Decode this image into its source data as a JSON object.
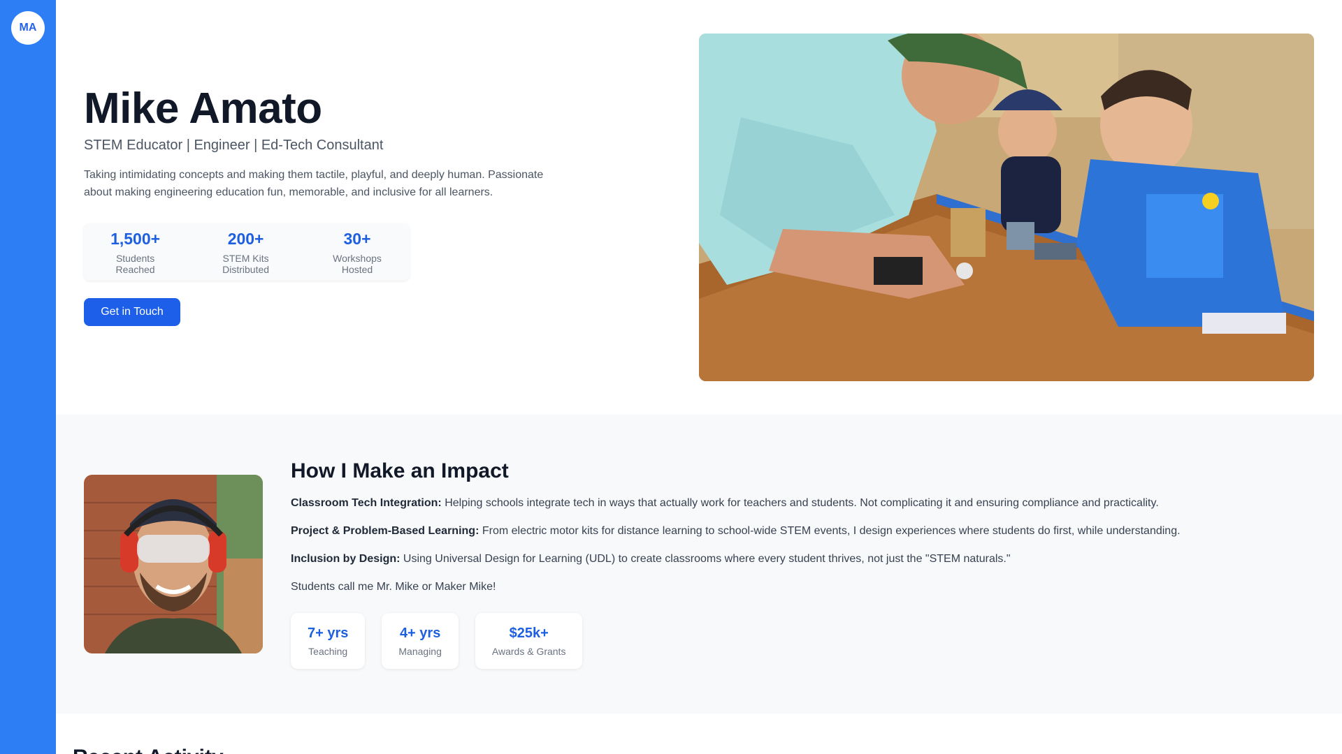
{
  "sidebar": {
    "initials": "MA",
    "accent_color": "#2d7df5"
  },
  "hero": {
    "name": "Mike Amato",
    "subtitle": "STEM Educator | Engineer | Ed-Tech Consultant",
    "description": "Taking intimidating concepts and making them tactile, playful, and deeply human. Passionate about making engineering education fun, memorable, and inclusive for all learners.",
    "stats": [
      {
        "value": "1,500+",
        "label": "Students Reached"
      },
      {
        "value": "200+",
        "label": "STEM Kits Distributed"
      },
      {
        "value": "30+",
        "label": "Workshops Hosted"
      }
    ],
    "cta_label": "Get in Touch",
    "cta_color": "#1d5fe8"
  },
  "impact": {
    "title": "How I Make an Impact",
    "items": [
      {
        "heading": "Classroom Tech Integration:",
        "text": "Helping schools integrate tech in ways that actually work for teachers and students. Not complicating it and ensuring compliance and practicality."
      },
      {
        "heading": "Project & Problem-Based Learning:",
        "text": "From electric motor kits for distance learning to school-wide STEM events, I design experiences where students do first, while understanding."
      },
      {
        "heading": "Inclusion by Design:",
        "text": "Using Universal Design for Learning (UDL) to create classrooms where every student thrives, not just the \"STEM naturals.\""
      }
    ],
    "note": "Students call me Mr. Mike or Maker Mike!",
    "mini_stats": [
      {
        "value": "7+ yrs",
        "label": "Teaching"
      },
      {
        "value": "4+ yrs",
        "label": "Managing"
      },
      {
        "value": "$25k+",
        "label": "Awards & Grants"
      }
    ]
  },
  "recent": {
    "title": "Recent Activity"
  }
}
